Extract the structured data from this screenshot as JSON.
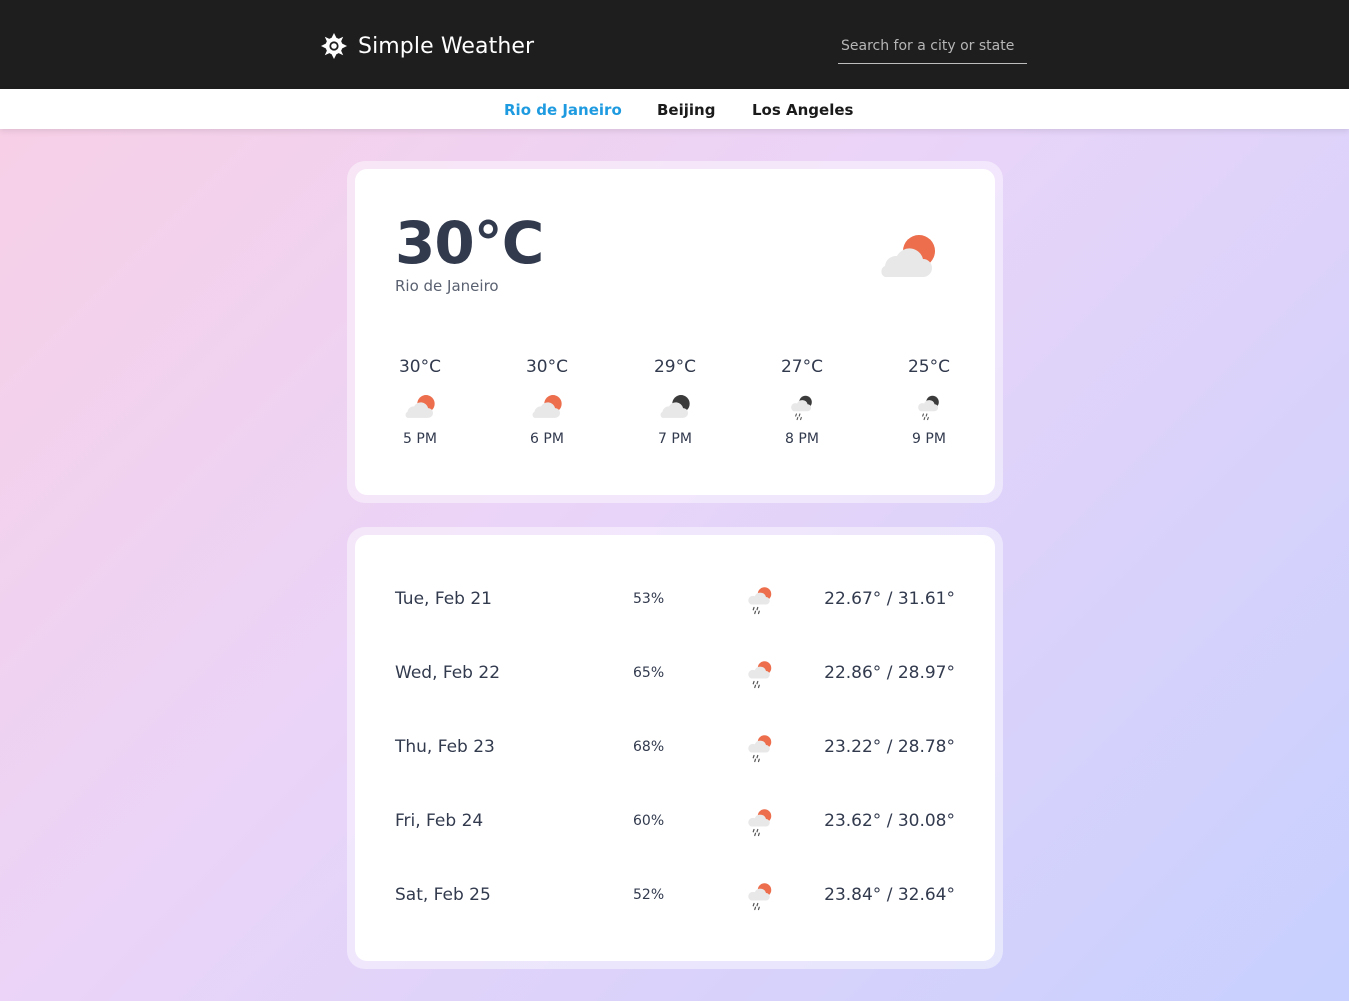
{
  "header": {
    "app_name": "Simple Weather",
    "logo_icon": "sun-gear-icon",
    "search_placeholder": "Search for a city or state"
  },
  "cities": {
    "active": "Rio de Janeiro",
    "items": [
      {
        "label": "Rio de Janeiro"
      },
      {
        "label": "Beijing"
      },
      {
        "label": "Los Angeles"
      }
    ]
  },
  "current": {
    "temperature": "30°C",
    "city": "Rio de Janeiro",
    "icon": "partly-cloudy-day-icon"
  },
  "hourly": [
    {
      "temp": "30°C",
      "time": "5 PM",
      "icon": "partly-cloudy-day-icon"
    },
    {
      "temp": "30°C",
      "time": "6 PM",
      "icon": "partly-cloudy-day-icon"
    },
    {
      "temp": "29°C",
      "time": "7 PM",
      "icon": "partly-cloudy-night-icon"
    },
    {
      "temp": "27°C",
      "time": "8 PM",
      "icon": "rain-night-icon"
    },
    {
      "temp": "25°C",
      "time": "9 PM",
      "icon": "rain-night-icon"
    }
  ],
  "daily": [
    {
      "day": "Tue, Feb 21",
      "precip": "53%",
      "range": "22.67° / 31.61°",
      "icon": "rain-day-icon"
    },
    {
      "day": "Wed, Feb 22",
      "precip": "65%",
      "range": "22.86° / 28.97°",
      "icon": "rain-day-icon"
    },
    {
      "day": "Thu, Feb 23",
      "precip": "68%",
      "range": "23.22° / 28.78°",
      "icon": "rain-day-icon"
    },
    {
      "day": "Fri, Feb 24",
      "precip": "60%",
      "range": "23.62° / 30.08°",
      "icon": "rain-day-icon"
    },
    {
      "day": "Sat, Feb 25",
      "precip": "52%",
      "range": "23.84° / 32.64°",
      "icon": "rain-day-icon"
    }
  ],
  "colors": {
    "header_bg": "#1e1e1e",
    "active_tab": "#1e9be0",
    "text_primary": "#323a4e",
    "sun": "#ec6e4c",
    "moon": "#3b3b3b",
    "cloud": "#e6e6e6"
  }
}
